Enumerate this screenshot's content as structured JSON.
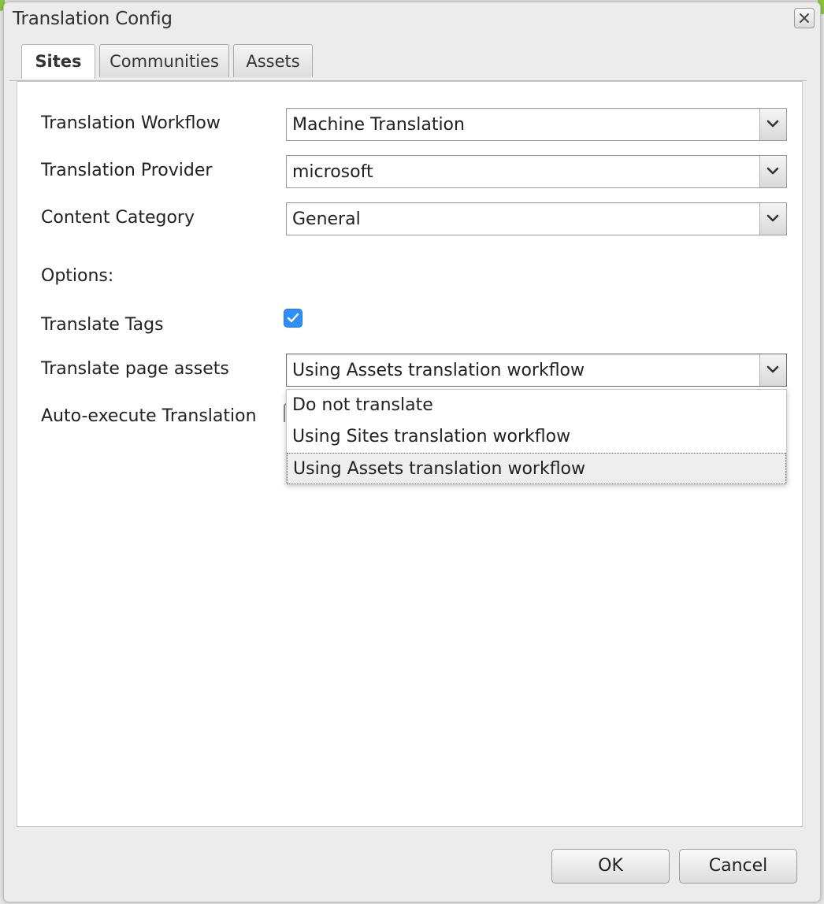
{
  "dialog": {
    "title": "Translation Config"
  },
  "tabs": [
    {
      "label": "Sites",
      "active": true
    },
    {
      "label": "Communities",
      "active": false
    },
    {
      "label": "Assets",
      "active": false
    }
  ],
  "form": {
    "translation_workflow": {
      "label": "Translation Workflow",
      "value": "Machine Translation"
    },
    "translation_provider": {
      "label": "Translation Provider",
      "value": "microsoft"
    },
    "content_category": {
      "label": "Content Category",
      "value": "General"
    },
    "options_label": "Options:",
    "translate_tags": {
      "label": "Translate Tags",
      "checked": true
    },
    "translate_page_assets": {
      "label": "Translate page assets",
      "value": "Using Assets translation workflow",
      "options": [
        "Do not translate",
        "Using Sites translation workflow",
        "Using Assets translation workflow"
      ],
      "selected_index": 2,
      "open": true
    },
    "auto_execute": {
      "label": "Auto-execute Translation"
    }
  },
  "footer": {
    "ok_label": "OK",
    "cancel_label": "Cancel"
  },
  "colors": {
    "checkbox_accent": "#2f8ef7",
    "brand_edge": "#8cc63f"
  },
  "icons": {
    "close": "close-icon",
    "dropdown": "chevron-down-icon",
    "check": "checkmark-icon"
  }
}
